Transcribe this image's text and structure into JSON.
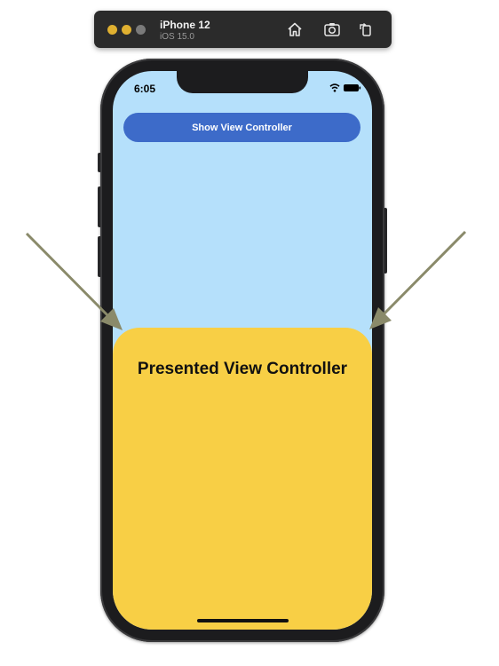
{
  "simulator": {
    "device_name": "iPhone 12",
    "os_version": "iOS 15.0",
    "icons": [
      "home-icon",
      "screenshot-icon",
      "rotate-icon"
    ]
  },
  "status_bar": {
    "time": "6:05",
    "icons": [
      "wifi-icon",
      "battery-icon"
    ]
  },
  "main": {
    "show_button_label": "Show View Controller",
    "background_color": "#b5e0fb",
    "button_color": "#3d6bc9"
  },
  "sheet": {
    "title": "Presented View Controller",
    "background_color": "#f8cf45"
  },
  "annotations": {
    "arrow_color": "#8a8a6a",
    "arrows": [
      "left-arrow",
      "right-arrow"
    ]
  }
}
